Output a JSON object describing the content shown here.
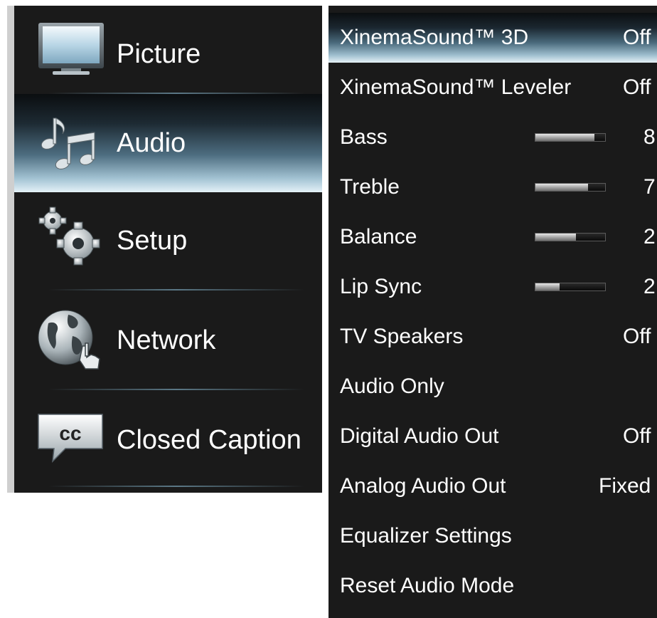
{
  "sidebar": {
    "items": [
      {
        "label": "Picture",
        "icon": "tv-icon",
        "selected": false
      },
      {
        "label": "Audio",
        "icon": "music-notes-icon",
        "selected": true
      },
      {
        "label": "Setup",
        "icon": "gears-icon",
        "selected": false
      },
      {
        "label": "Network",
        "icon": "globe-hand-icon",
        "selected": false
      },
      {
        "label": "Closed Caption",
        "icon": "cc-icon",
        "selected": false
      }
    ]
  },
  "audio_menu": {
    "rows": [
      {
        "label": "XinemaSound™ 3D",
        "value": "Off",
        "selected": true
      },
      {
        "label": "XinemaSound™ Leveler",
        "value": "Off"
      },
      {
        "label": "Bass",
        "value": "8",
        "level_percent": 85
      },
      {
        "label": "Treble",
        "value": "7",
        "level_percent": 75
      },
      {
        "label": "Balance",
        "value": "2",
        "level_percent": 58
      },
      {
        "label": "Lip Sync",
        "value": "2",
        "level_percent": 35
      },
      {
        "label": "TV Speakers",
        "value": "Off"
      },
      {
        "label": "Audio Only",
        "value": ""
      },
      {
        "label": "Digital Audio Out",
        "value": "Off"
      },
      {
        "label": "Analog Audio Out",
        "value": "Fixed"
      },
      {
        "label": "Equalizer Settings",
        "value": ""
      },
      {
        "label": "Reset Audio Mode",
        "value": ""
      }
    ]
  },
  "colors": {
    "panel_background": "#1a1a1a",
    "highlight_light": "#e4f1f7",
    "highlight_dark": "#0b0e10",
    "text": "#ffffff"
  }
}
